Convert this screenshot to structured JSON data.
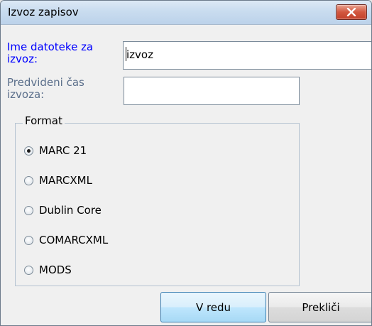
{
  "window": {
    "title": "Izvoz zapisov"
  },
  "form": {
    "filename_label": "Ime datoteke za izvoz:",
    "filename_value": "izvoz",
    "time_label": "Predvideni čas izvoza:",
    "time_value": ""
  },
  "format": {
    "legend": "Format",
    "options": [
      {
        "label": "MARC 21",
        "checked": true
      },
      {
        "label": "MARCXML",
        "checked": false
      },
      {
        "label": "Dublin Core",
        "checked": false
      },
      {
        "label": "COMARCXML",
        "checked": false
      },
      {
        "label": "MODS",
        "checked": false
      }
    ]
  },
  "buttons": {
    "ok": "V redu",
    "cancel": "Prekliči"
  },
  "icons": {
    "close": "close-icon"
  }
}
